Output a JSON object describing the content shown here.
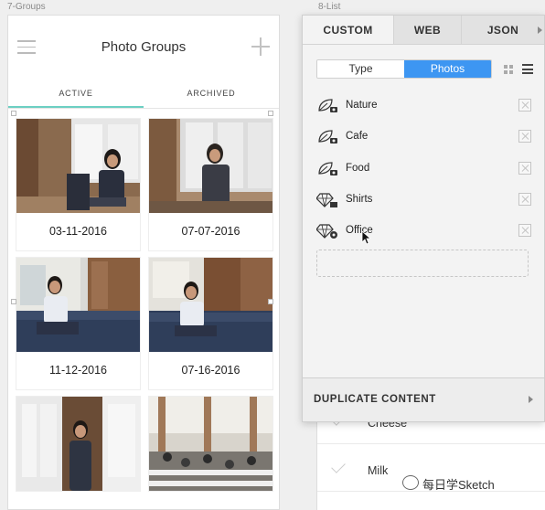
{
  "artboards": {
    "left_label": "7-Groups",
    "right_label": "8-List"
  },
  "groups_screen": {
    "title": "Photo Groups",
    "tabs": [
      {
        "label": "ACTIVE",
        "active": true
      },
      {
        "label": "ARCHIVED",
        "active": false
      }
    ],
    "cards": [
      {
        "date": "03-11-2016",
        "scene": "woman-on-chair-loft"
      },
      {
        "date": "07-07-2016",
        "scene": "woman-by-window"
      },
      {
        "date": "11-12-2016",
        "scene": "woman-on-sofa"
      },
      {
        "date": "07-16-2016",
        "scene": "woman-on-sofa-brick"
      },
      {
        "date": "",
        "scene": "woman-standing-window"
      },
      {
        "date": "",
        "scene": "open-office"
      }
    ]
  },
  "panel": {
    "tabs": [
      {
        "label": "CUSTOM",
        "active": true
      },
      {
        "label": "WEB",
        "active": false
      },
      {
        "label": "JSON",
        "active": false
      }
    ],
    "segmented": [
      {
        "label": "Type",
        "active": false
      },
      {
        "label": "Photos",
        "active": true
      }
    ],
    "items": [
      {
        "label": "Nature",
        "icon": "leaf-camera-icon"
      },
      {
        "label": "Cafe",
        "icon": "leaf-camera-icon"
      },
      {
        "label": "Food",
        "icon": "leaf-camera-icon"
      },
      {
        "label": "Shirts",
        "icon": "diamond-folder-icon"
      },
      {
        "label": "Office",
        "icon": "diamond-sync-icon"
      }
    ],
    "duplicate_label": "DUPLICATE CONTENT"
  },
  "list_screen": {
    "rows": [
      {
        "label": "Cheese"
      },
      {
        "label": "Milk"
      }
    ]
  },
  "watermark": "每日学Sketch",
  "colors": {
    "accent_blue": "#3d96f2",
    "tab_underline": "#6cd0c3"
  }
}
